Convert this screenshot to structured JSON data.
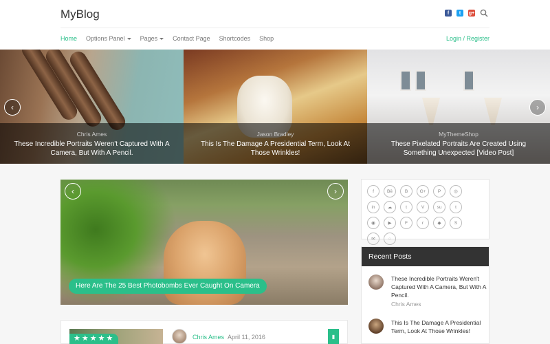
{
  "header": {
    "logo": "MyBlog",
    "social_icons": [
      "facebook-icon",
      "twitter-icon",
      "google-plus-icon"
    ],
    "fb_glyph": "f",
    "tw_glyph": "t",
    "gp_glyph": "g+",
    "nav": [
      {
        "label": "Home",
        "active": true
      },
      {
        "label": "Options Panel",
        "dropdown": true
      },
      {
        "label": "Pages",
        "dropdown": true
      },
      {
        "label": "Contact Page"
      },
      {
        "label": "Shortcodes"
      },
      {
        "label": "Shop"
      }
    ],
    "login": "Login / Register",
    "accent": "#2bbf8a"
  },
  "top_slider": {
    "prev_glyph": "‹",
    "next_glyph": "›",
    "slides": [
      {
        "author": "Chris Ames",
        "title": "These Incredible Portraits Weren't Captured With A Camera, But With A Pencil."
      },
      {
        "author": "Jason Bradley",
        "title": "This Is The Damage A Presidential Term, Look At Those Wrinkles!"
      },
      {
        "author": "MyThemeShop",
        "title": "These Pixelated Portraits Are Created Using Something Unexpected [Video Post]"
      }
    ]
  },
  "featured": {
    "title": "Here Are The 25 Best Photobombs Ever Caught On Camera",
    "prev_glyph": "‹",
    "next_glyph": "›"
  },
  "post": {
    "stars": "★★★★★",
    "author": "Chris Ames",
    "date": "April 11, 2016",
    "bookmark_glyph": "▮"
  },
  "social_widget": {
    "icons": [
      {
        "name": "facebook-icon",
        "glyph": "f"
      },
      {
        "name": "behance-icon",
        "glyph": "Bē"
      },
      {
        "name": "blogger-icon",
        "glyph": "B"
      },
      {
        "name": "google-plus-icon",
        "glyph": "G+"
      },
      {
        "name": "pinterest-icon",
        "glyph": "P"
      },
      {
        "name": "instagram-icon",
        "glyph": "◎"
      },
      {
        "name": "linkedin-icon",
        "glyph": "in"
      },
      {
        "name": "soundcloud-icon",
        "glyph": "☁"
      },
      {
        "name": "twitter-icon",
        "glyph": "t"
      },
      {
        "name": "vimeo-icon",
        "glyph": "V"
      },
      {
        "name": "stumbleupon-icon",
        "glyph": "su"
      },
      {
        "name": "tumblr-icon",
        "glyph": "t"
      },
      {
        "name": "github-icon",
        "glyph": "◉"
      },
      {
        "name": "youtube-icon",
        "glyph": "▶"
      },
      {
        "name": "foursquare-icon",
        "glyph": "F"
      },
      {
        "name": "reddit-icon",
        "glyph": "r"
      },
      {
        "name": "dropbox-icon",
        "glyph": "◆"
      },
      {
        "name": "skype-icon",
        "glyph": "S"
      },
      {
        "name": "email-icon",
        "glyph": "✉"
      },
      {
        "name": "rss-icon",
        "glyph": "◌"
      }
    ]
  },
  "recent_posts": {
    "heading": "Recent Posts",
    "items": [
      {
        "title": "These Incredible Portraits Weren't Captured With A Camera, But With A Pencil.",
        "author": "Chris Ames"
      },
      {
        "title": "This Is The Damage A Presidential Term, Look At Those Wrinkles!",
        "author": ""
      }
    ]
  }
}
